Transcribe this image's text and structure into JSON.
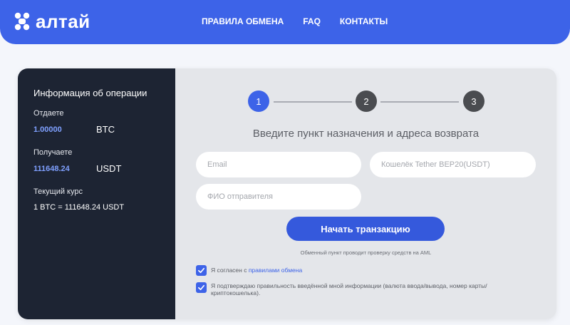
{
  "brand": {
    "name": "алтай",
    "colors": {
      "primary": "#3d63e8",
      "sidebar": "#1d2433",
      "panel": "#e4e6ea"
    }
  },
  "nav": {
    "items": [
      "ПРАВИЛА ОБМЕНА",
      "FAQ",
      "КОНТАКТЫ"
    ]
  },
  "summary": {
    "title": "Информация об операции",
    "give_label": "Отдаете",
    "give_amount": "1.00000",
    "give_currency": "BTC",
    "receive_label": "Получаете",
    "receive_amount": "111648.24",
    "receive_currency": "USDT",
    "rate_label": "Текущий курс",
    "rate_value": "1 BTC = 111648.24 USDT"
  },
  "stepper": {
    "steps": [
      "1",
      "2",
      "3"
    ],
    "active": 1
  },
  "form": {
    "title": "Введите пункт назначения и адреса возврата",
    "email_placeholder": "Email",
    "wallet_placeholder": "Кошелёк Tether BEP20(USDT)",
    "name_placeholder": "ФИО отправителя",
    "submit_label": "Начать транзакцию",
    "aml_note": "Обменный пункт проводит проверку средств на AML",
    "agree_prefix": "Я согласен с ",
    "agree_link": "правилами обмена",
    "confirm_text": "Я подтверждаю правильность введённой мной информации (валюта ввода/вывода, номер карты/криптокошелька).",
    "agree_checked": true,
    "confirm_checked": true
  }
}
